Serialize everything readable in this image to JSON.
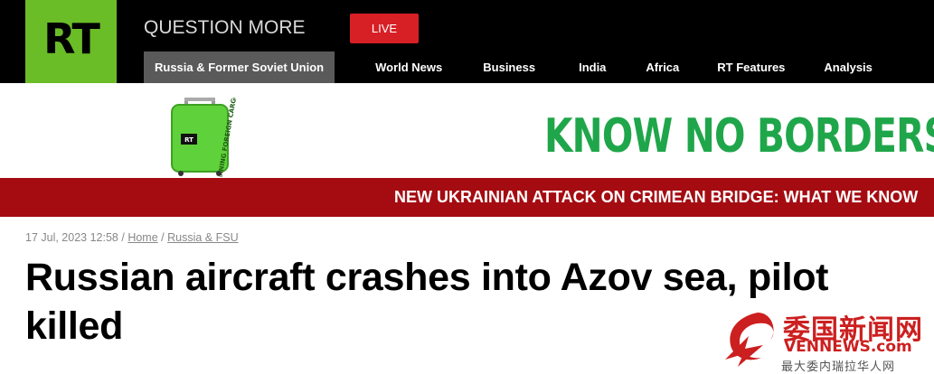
{
  "header": {
    "logo_text": "RT",
    "tagline": "QUESTION MORE",
    "live_label": "LIVE",
    "nav": [
      {
        "label": "Russia & Former Soviet Union",
        "active": true
      },
      {
        "label": "World News"
      },
      {
        "label": "Business"
      },
      {
        "label": "India"
      },
      {
        "label": "Africa"
      },
      {
        "label": "RT Features"
      },
      {
        "label": "Analysis"
      }
    ]
  },
  "banner": {
    "slogan": "KNOW NO BORDERS",
    "suitcase_text": "WARNING FOREIGN CARGO",
    "suitcase_logo": "RT"
  },
  "breaking": {
    "text": "NEW UKRAINIAN ATTACK ON CRIMEAN BRIDGE: WHAT WE KNOW"
  },
  "article": {
    "date": "17 Jul, 2023 12:58",
    "separator": "/",
    "breadcrumb": [
      "Home",
      "Russia & FSU"
    ],
    "title": "Russian aircraft crashes into Azov sea, pilot killed"
  },
  "watermark": {
    "zh": "委国新闻网",
    "en": "VENNEWS.com",
    "sub": "最大委内瑞拉华人网"
  },
  "colors": {
    "logo_green": "#6bbd28",
    "live_red": "#d71f26",
    "breaking_red": "#a50c12",
    "slogan_green": "#1fa64a"
  }
}
